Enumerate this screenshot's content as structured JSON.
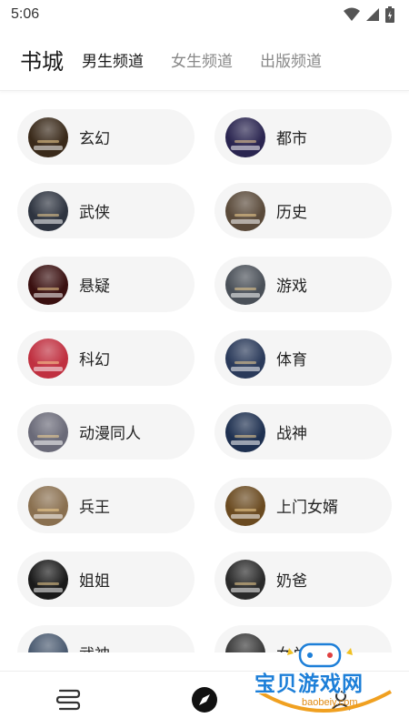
{
  "status": {
    "time": "5:06"
  },
  "header": {
    "title": "书城",
    "tabs": [
      {
        "label": "男生频道",
        "active": true
      },
      {
        "label": "女生频道",
        "active": false
      },
      {
        "label": "出版频道",
        "active": false
      }
    ]
  },
  "categories": [
    {
      "label": "玄幻",
      "cover_color": "#3a2a1a"
    },
    {
      "label": "都市",
      "cover_color": "#2a2550"
    },
    {
      "label": "武侠",
      "cover_color": "#2e3440"
    },
    {
      "label": "历史",
      "cover_color": "#5a4a3a"
    },
    {
      "label": "悬疑",
      "cover_color": "#3a1010"
    },
    {
      "label": "游戏",
      "cover_color": "#4a5058"
    },
    {
      "label": "科幻",
      "cover_color": "#c03040"
    },
    {
      "label": "体育",
      "cover_color": "#2a3a5a"
    },
    {
      "label": "动漫同人",
      "cover_color": "#6a6a78"
    },
    {
      "label": "战神",
      "cover_color": "#1e3050"
    },
    {
      "label": "兵王",
      "cover_color": "#8a7050"
    },
    {
      "label": "上门女婿",
      "cover_color": "#6a4a20"
    },
    {
      "label": "姐姐",
      "cover_color": "#1a1a1a"
    },
    {
      "label": "奶爸",
      "cover_color": "#2a2a2a"
    },
    {
      "label": "武神",
      "cover_color": "#4a5a70"
    },
    {
      "label": "女总",
      "cover_color": "#3a3a3a"
    }
  ],
  "bottom_nav": [
    {
      "icon": "bookshelf-icon"
    },
    {
      "icon": "compass-icon",
      "active": true
    },
    {
      "icon": "profile-icon"
    }
  ],
  "watermark": {
    "title": "宝贝游戏网",
    "url": "baobeiy.com"
  },
  "colors": {
    "pill_bg": "#f5f5f5",
    "active_text": "#1a1a1a",
    "inactive_text": "#888888"
  }
}
